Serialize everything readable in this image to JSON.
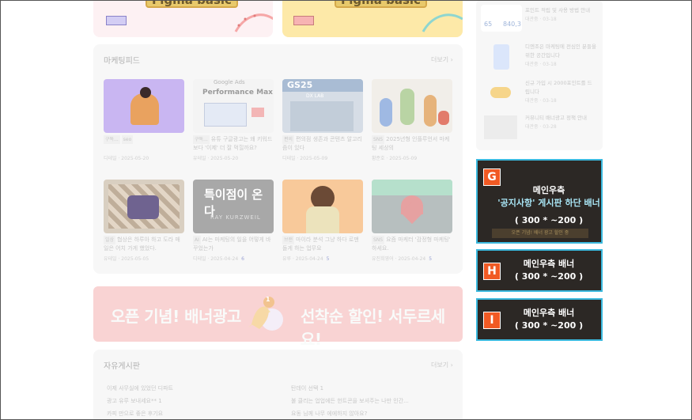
{
  "top_banners": {
    "left_label": "Figma basic",
    "right_label": "Figma basic"
  },
  "marketing_feed": {
    "title": "마케팅피드",
    "more": "더보기",
    "items": [
      {
        "tags": [
          "구독...",
          "seo"
        ],
        "title": "",
        "author": "디테일",
        "date": "2025-05-20",
        "count": ""
      },
      {
        "tags": [
          "구독..."
        ],
        "title": "유튜 구글광고는 왜 키워드보다 '이제' 더 잘 먹힐까요?",
        "author": "유테일",
        "date": "2025-05-20",
        "count": ""
      },
      {
        "tags": [
          "편의"
        ],
        "title": "편의점 생존과 콘텐츠 알고리즘이 있다",
        "author": "디테일",
        "date": "2025-05-09",
        "count": ""
      },
      {
        "tags": [
          "SNS"
        ],
        "title": "2025년형 인플루언서 마케팅 세상의",
        "author": "황준호",
        "date": "2025-05-09",
        "count": ""
      },
      {
        "tags": [
          "일상"
        ],
        "title": "협상은 하루아 하고 도라 매일은 어치 가게 했었다.",
        "author": "유테일",
        "date": "2025-05-05",
        "count": ""
      },
      {
        "tags": [
          "AI"
        ],
        "title": "AI는 마케팅의 일을 어떻게 바꾸었는가",
        "author": "디테일",
        "date": "2025-04-24",
        "count": "6"
      },
      {
        "tags": [
          "브랜"
        ],
        "title": "마이라 분석 그냥 하다 로맨 돌게 하는 업무요",
        "author": "유루",
        "date": "2025-04-24",
        "count": "5"
      },
      {
        "tags": [
          "SNS"
        ],
        "title": "요즘 마케터 '감정형 마케팅' 하세요.",
        "author": "유진희영어",
        "date": "2025-04-24",
        "count": "5"
      }
    ]
  },
  "feed_images": {
    "performance_brand": "Google Ads",
    "performance_title": "Performance Max",
    "gs_sign": "GS25",
    "gs_sub": "DX LAB",
    "kurzweil_title": "특이점이 온다",
    "kurzweil_author": "RAY KURZWEIL"
  },
  "promo_banner": {
    "left_text": "오픈 기념! 배너광고",
    "right_text": "선착순 할인! 서두르세요!",
    "bell_count": "1"
  },
  "free_board": {
    "title": "자유게시판",
    "more": "더보기",
    "left_rows": [
      "이제 사무실에 있었던 디파트",
      "광고 유루 보내세요** 1",
      "카피 만으로 좋은 후기요"
    ],
    "right_rows": [
      "탄데이 선택 1",
      "불 클리는 업업에든 헌트콘을 보셔주는 나만 인간...",
      "요동 님께 나무 에에하지 않아요?"
    ]
  },
  "side_list": {
    "stat_left": "65",
    "stat_right": "840,3",
    "items": [
      {
        "title": "포인트 적립 및 사용 방법 안내",
        "meta": "대관중 · 03-18"
      },
      {
        "title": "디엔조은 마케팅에 전심인 분들을 위한 공간입니다",
        "meta": "대관중 · 03-18"
      },
      {
        "title": "신규 가입 시 2000포인트를 드립니다",
        "meta": "대관중 · 03-18"
      },
      {
        "title": "커뮤니티 배너광고 정책 안내",
        "meta": "대관중 · 03-28"
      }
    ]
  },
  "ads": [
    {
      "badge": "G",
      "line1": "메인우측",
      "line2": "'공지사항' 게시판 하단 배너",
      "size": "( 300 * ~200 )",
      "extra": "오픈 기념! 배너 광고 할인 중"
    },
    {
      "badge": "H",
      "line1": "메인우측 배너",
      "line2": "",
      "size": "( 300 * ~200 )",
      "extra": ""
    },
    {
      "badge": "I",
      "line1": "메인우측 배너",
      "line2": "",
      "size": "( 300 * ~200 )",
      "extra": ""
    }
  ],
  "colors": {
    "ad_border": "#3bb9de",
    "ad_badge": "#f15a24",
    "promo_bg": "#f9d3d3",
    "banner_left": "#fff3f3",
    "banner_right": "#fde9a8"
  }
}
